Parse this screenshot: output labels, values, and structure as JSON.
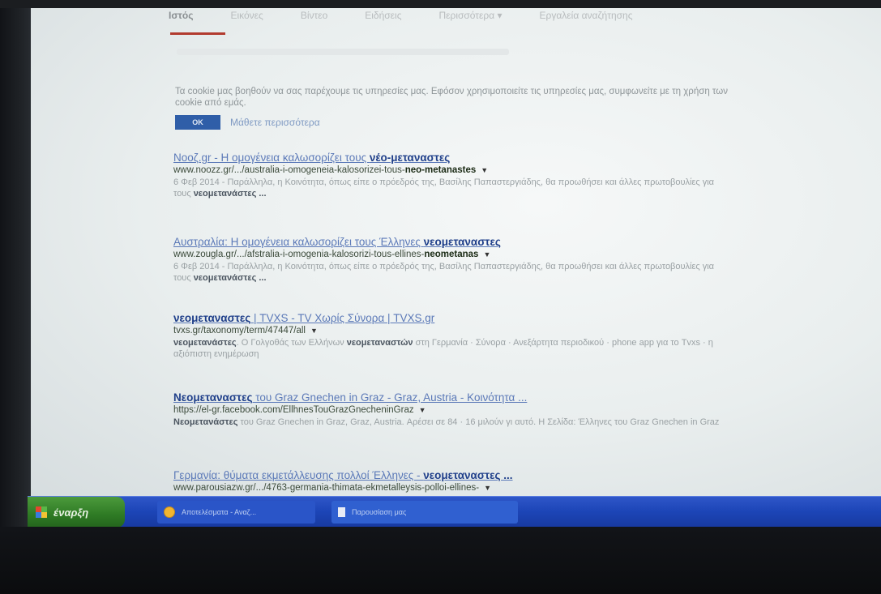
{
  "tabs": [
    {
      "label": "Ιστός",
      "active": true
    },
    {
      "label": "Εικόνες",
      "active": false
    },
    {
      "label": "Βίντεο",
      "active": false
    },
    {
      "label": "Ειδήσεις",
      "active": false
    },
    {
      "label": "Περισσότερα ▾",
      "active": false
    },
    {
      "label": "Εργαλεία αναζήτησης",
      "active": false
    }
  ],
  "cookie_notice": {
    "text": "Τα cookie μας βοηθούν να σας παρέχουμε τις υπηρεσίες μας. Εφόσον χρησιμοποιείτε τις υπηρεσίες μας, συμφωνείτε με τη χρήση των cookie από εμάς.",
    "ok_label": "OK",
    "learn_more": "Μάθετε περισσότερα"
  },
  "results": [
    {
      "title_pre": "Νοοζ.gr - Η ομογένεια καλωσορίζει τους ",
      "title_bold": "νέο-μεταναστες",
      "url_pre": "www.noozz.gr/.../australia-i-omogeneia-kalosorizei-tous-",
      "url_bold": "neo-metanastes",
      "snippet_pre": "6 Φεβ 2014 - Παράλληλα, η Κοινότητα, όπως είπε ο πρόεδρός της, Βασίλης Παπαστεργιάδης, θα προωθήσει και άλλες πρωτοβουλίες για τους ",
      "snippet_bold": "νεομετανάστες ..."
    },
    {
      "title_pre": "Αυστραλία: Η ομογένεια καλωσορίζει τους Έλληνες ",
      "title_bold": "νεομεταναστες",
      "url_pre": "www.zougla.gr/.../afstralia-i-omogenia-kalosorizi-tous-ellines-",
      "url_bold": "neometanas",
      "snippet_pre": "6 Φεβ 2014 - Παράλληλα, η Κοινότητα, όπως είπε ο πρόεδρός της, Βασίλης Παπαστεργιάδης, θα προωθήσει και άλλες πρωτοβουλίες για τους ",
      "snippet_bold": "νεομετανάστες ..."
    },
    {
      "title_pre": "",
      "title_bold": "νεομεταναστες",
      "title_post": " | TVXS - TV Χωρίς Σύνορα | TVXS.gr",
      "url_pre": "tvxs.gr/taxonomy/term/47447/all",
      "url_bold": "",
      "snippet_bold_lead": "νεομετανάστες",
      "snippet_pre": ". Ο Γολγοθάς των Ελλήνων ",
      "snippet_bold": "νεομεταναστών",
      "snippet_post": " στη Γερμανία · Σύνορα · Ανεξάρτητα περιοδικού · phone app για το Tvxs · η αξιόπιστη ενημέρωση"
    },
    {
      "title_pre": "",
      "title_bold": "Νεομεταναστες",
      "title_post": " του Graz Gnechen in Graz - Graz, Austria - Κοινότητα ...",
      "url_pre": "https://el-gr.facebook.com/EllhnesTouGrazGnecheninGraz",
      "url_bold": "",
      "snippet_bold_lead": "Νεομετανάστες",
      "snippet_pre": " του Graz Gnechen in Graz, Graz, Austria. Αρέσει σε 84 · 16 μιλούν γι αυτό. Η Σελίδα: Έλληνες του Graz Gnechen in Graz",
      "snippet_bold": ""
    },
    {
      "title_pre": "Γερμανία: θύματα εκμετάλλευσης πολλοί Έλληνες - ",
      "title_bold": "νεομεταναστες ...",
      "url_pre": "www.parousiazw.gr/.../4763-germania-thimata-ekmetalleysis-polloi-ellines-",
      "url_bold": "",
      "snippet_pre": "",
      "snippet_bold": ""
    }
  ],
  "taskbar": {
    "start_label": "έναρξη",
    "task_browser": "Αποτελέσματα - Αναζ...",
    "task_document": "Παρουσίαση μας"
  }
}
